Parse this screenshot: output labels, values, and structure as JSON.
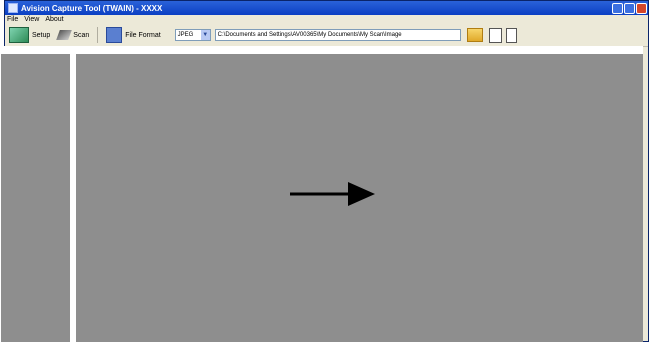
{
  "window": {
    "title": "Avision Capture Tool (TWAIN) - XXXX"
  },
  "menu": [
    "File",
    "View",
    "About"
  ],
  "toolbar": {
    "setup_label": "Setup",
    "scan_label": "Scan",
    "file_format_label": "File Format",
    "format_value": "JPEG",
    "path_value": "C:\\Documents and Settings\\AV00365\\My Documents\\My Scan\\Image"
  },
  "icons": {
    "setup": "setup-icon",
    "scan": "scan-icon",
    "file_format": "file-format-icon",
    "folder": "folder-icon",
    "frame": "frame-icon",
    "page": "page-icon"
  },
  "colors": {
    "title_bar": "#0b3fc3",
    "pane_bg": "#8e8e8e"
  }
}
